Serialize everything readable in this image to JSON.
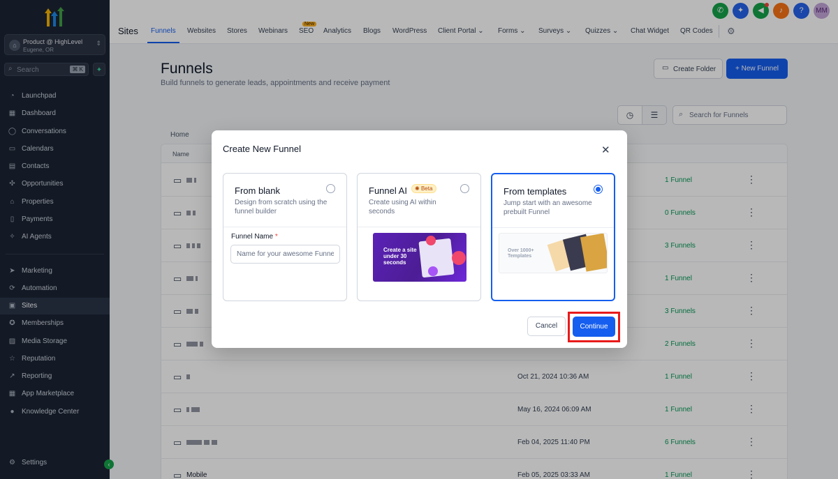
{
  "sidebar": {
    "account": {
      "name": "Product @ HighLevel",
      "location": "Eugene, OR"
    },
    "search": {
      "placeholder": "Search",
      "shortcut": "⌘ K"
    },
    "items": [
      {
        "label": "Launchpad",
        "icon": "rocket-icon"
      },
      {
        "label": "Dashboard",
        "icon": "grid-icon"
      },
      {
        "label": "Conversations",
        "icon": "chat-icon"
      },
      {
        "label": "Calendars",
        "icon": "calendar-icon"
      },
      {
        "label": "Contacts",
        "icon": "contact-card-icon"
      },
      {
        "label": "Opportunities",
        "icon": "network-icon"
      },
      {
        "label": "Properties",
        "icon": "home-icon"
      },
      {
        "label": "Payments",
        "icon": "receipt-icon"
      },
      {
        "label": "AI Agents",
        "icon": "sparkle-icon"
      },
      {
        "label": "Marketing",
        "icon": "send-icon"
      },
      {
        "label": "Automation",
        "icon": "automation-icon"
      },
      {
        "label": "Sites",
        "icon": "sites-icon"
      },
      {
        "label": "Memberships",
        "icon": "badge-icon"
      },
      {
        "label": "Media Storage",
        "icon": "image-icon"
      },
      {
        "label": "Reputation",
        "icon": "star-icon"
      },
      {
        "label": "Reporting",
        "icon": "trend-icon"
      },
      {
        "label": "App Marketplace",
        "icon": "apps-icon"
      },
      {
        "label": "Knowledge Center",
        "icon": "info-icon"
      }
    ],
    "settings": "Settings"
  },
  "topbar": {
    "section": "Sites",
    "tabs": [
      "Funnels",
      "Websites",
      "Stores",
      "Webinars",
      "SEO",
      "Analytics",
      "Blogs",
      "WordPress",
      "Client Portal",
      "Forms",
      "Surveys",
      "Quizzes",
      "Chat Widget",
      "QR Codes"
    ],
    "new_badge": "New",
    "avatar": "MM"
  },
  "page": {
    "title": "Funnels",
    "subtitle": "Build funnels to generate leads, appointments and receive payment",
    "create_folder": "Create Folder",
    "new_funnel": "+ New Funnel",
    "search_placeholder": "Search for Funnels",
    "breadcrumb": "Home",
    "column_name": "Name"
  },
  "rows": [
    {
      "name": "",
      "date": "",
      "count": "1 Funnel"
    },
    {
      "name": "",
      "date": "",
      "count": "0 Funnels"
    },
    {
      "name": "",
      "date": "",
      "count": "3 Funnels"
    },
    {
      "name": "",
      "date": "",
      "count": "1 Funnel"
    },
    {
      "name": "",
      "date": "",
      "count": "3 Funnels"
    },
    {
      "name": "",
      "date": "",
      "count": "2 Funnels"
    },
    {
      "name": "",
      "date": "Oct 21, 2024 10:36 AM",
      "count": "1 Funnel"
    },
    {
      "name": "",
      "date": "May 16, 2024 06:09 AM",
      "count": "1 Funnel"
    },
    {
      "name": "",
      "date": "Feb 04, 2025 11:40 PM",
      "count": "6 Funnels"
    },
    {
      "name": "Mobile",
      "date": "Feb 05, 2025 03:33 AM",
      "count": "1 Funnel"
    }
  ],
  "modal": {
    "title": "Create New Funnel",
    "cards": {
      "blank": {
        "title": "From blank",
        "desc": "Design from scratch using the funnel builder",
        "field_label": "Funnel Name",
        "required_mark": "*",
        "placeholder": "Name for your awesome Funnel"
      },
      "ai": {
        "title": "Funnel AI",
        "badge": "Beta",
        "desc": "Create using AI within seconds",
        "image_text": "Create a site under 30 seconds"
      },
      "templates": {
        "title": "From templates",
        "desc": "Jump start with an awesome prebuilt Funnel",
        "image_text": "Over 1000+ Templates"
      }
    },
    "selected": "templates",
    "cancel": "Cancel",
    "continue": "Continue"
  },
  "colors": {
    "primary": "#155eef",
    "sidebar": "#1c2434",
    "highlight": "#e81a1a",
    "success": "#039855"
  }
}
